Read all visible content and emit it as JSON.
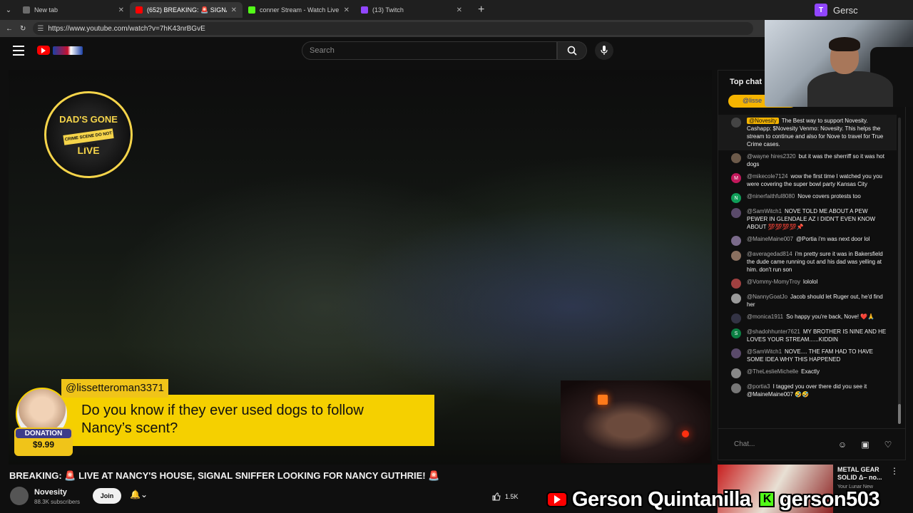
{
  "browser": {
    "tabs": [
      {
        "label": "New tab",
        "active": false,
        "favicon_color": "#6b6b6b"
      },
      {
        "label": "(652) BREAKING: 🚨 SIGNAL",
        "active": true,
        "favicon_color": "#ff0000"
      },
      {
        "label": "conner Stream - Watch Live o",
        "active": false,
        "favicon_color": "#53fc18"
      },
      {
        "label": "(13) Twitch",
        "active": false,
        "favicon_color": "#9146ff"
      }
    ],
    "url": "https://www.youtube.com/watch?v=7hK43nrBGvE",
    "profile_name": "Gersc"
  },
  "header": {
    "search_placeholder": "Search"
  },
  "video": {
    "badge_top": "DAD'S GONE",
    "badge_mid": "CRIME SCENE DO NOT CROSS",
    "badge_bottom": "LIVE",
    "donation": {
      "username": "@lissetteroman3371",
      "message": "Do you know if they ever used dogs to follow Nancy’s scent?",
      "tag_label": "DONATION",
      "amount": "$9.99"
    },
    "title": "BREAKING: 🚨 LIVE AT NANCY'S HOUSE, SIGNAL SNIFFER LOOKING FOR NANCY GUTHRIE! 🚨",
    "channel": {
      "name": "Novesity",
      "subscribers": "88.3K subscribers",
      "join_label": "Join"
    },
    "likes": "1.5K"
  },
  "chat": {
    "mode_label": "Top chat",
    "pinned_user": "@lisse",
    "input_placeholder": "Chat...",
    "messages": [
      {
        "author": "@Novesity",
        "text": "The Best way to support Novesity. Cashapp: $Novesity Venmo: Novesity. This helps the stream to continue and also for Nove to travel for True Crime cases.",
        "highlight": true,
        "avatar_color": "#444",
        "initial": ""
      },
      {
        "author": "@wayne hires2320",
        "text": "but it was the sherriff so it was hot dogs",
        "highlight": false,
        "avatar_color": "#6c5a4a",
        "initial": ""
      },
      {
        "author": "@mikecole7124",
        "text": "wow the first time I watched you you were covering the super bowl party Kansas City",
        "highlight": false,
        "avatar_color": "#c2185b",
        "initial": "M"
      },
      {
        "author": "@ninerfaithful8080",
        "text": "Nove covers protests too",
        "highlight": false,
        "avatar_color": "#0f9d58",
        "initial": "N"
      },
      {
        "author": "@SamWitch1",
        "text": "NOVE TOLD ME ABOUT A PEW PEWER IN GLENDALE AZ I DIDN'T EVEN KNOW ABOUT 💯💯💯💯📌",
        "highlight": false,
        "avatar_color": "#5a4a6a",
        "initial": ""
      },
      {
        "author": "@MaineMaine007",
        "text": "@Portia i'm was next door lol",
        "highlight": false,
        "avatar_color": "#7a6a8a",
        "initial": ""
      },
      {
        "author": "@averagedad814",
        "text": "i'm pretty sure it was in Bakersfield the dude came running out and his dad was yelling at him. don't run son",
        "highlight": false,
        "avatar_color": "#8a7060",
        "initial": ""
      },
      {
        "author": "@Vommy-MomyTroy",
        "text": "lololol",
        "highlight": false,
        "avatar_color": "#a04040",
        "initial": ""
      },
      {
        "author": "@NannyGoatJo",
        "text": "Jacob should let Ruger out, he'd find her",
        "highlight": false,
        "avatar_color": "#9a9a9a",
        "initial": ""
      },
      {
        "author": "@monica1911",
        "text": "So happy you're back, Nove! ❤️🙏",
        "highlight": false,
        "avatar_color": "#334",
        "initial": ""
      },
      {
        "author": "@shadohhunter7621",
        "text": "MY BROTHER IS NINE AND HE LOVES YOUR STREAM......KIDDIN",
        "highlight": false,
        "avatar_color": "#0b8043",
        "initial": "S"
      },
      {
        "author": "@SamWitch1",
        "text": "NOVE.... THE FAM HAD TO HAVE SOME IDEA WHY THIS HAPPENED",
        "highlight": false,
        "avatar_color": "#5a4a6a",
        "initial": ""
      },
      {
        "author": "@TheLeslieMichelle",
        "text": "Exactly",
        "highlight": false,
        "avatar_color": "#888",
        "initial": ""
      },
      {
        "author": "@portia3",
        "text": "I tagged you over there did you see it @MaineMaine007 🤣🤣",
        "highlight": false,
        "avatar_color": "#777",
        "initial": ""
      }
    ]
  },
  "recommended": {
    "title": "METAL GEAR SOLID Δ– no...",
    "subtitle": "Your Lunar New"
  },
  "overlay": {
    "youtube_name": "Gerson Quintanilla",
    "kick_name": "gerson503"
  }
}
